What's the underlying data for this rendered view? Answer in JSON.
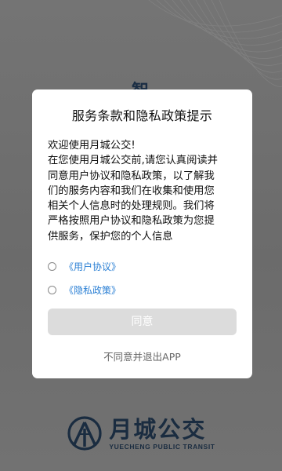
{
  "background": {
    "partial_char": "智",
    "brand": {
      "name_cn": "月城公交",
      "name_en": "YUECHENG PUBLIC TRANSIT"
    },
    "colors": {
      "dim_overlay": "#707070",
      "brand_navy": "#1a2c40"
    }
  },
  "dialog": {
    "title": "服务条款和隐私政策提示",
    "body_lines": [
      "欢迎使用月城公交!",
      "在您使用月城公交前,请您认真阅读并",
      "同意用户协议和隐私政策，以了解我",
      "们的服务内容和我们在收集和使用您",
      "相关个人信息时的处理规则。我们将",
      "严格按照用户协议和隐私政策为您提",
      "供服务，保护您的个人信息"
    ],
    "agreements": [
      {
        "label": "《用户协议》",
        "checked": false
      },
      {
        "label": "《隐私政策》",
        "checked": false
      }
    ],
    "agree_button": "同意",
    "decline_link": "不同意并退出APP",
    "colors": {
      "link": "#2a7fd4",
      "agree_button_disabled": "#dcdcdc"
    }
  }
}
